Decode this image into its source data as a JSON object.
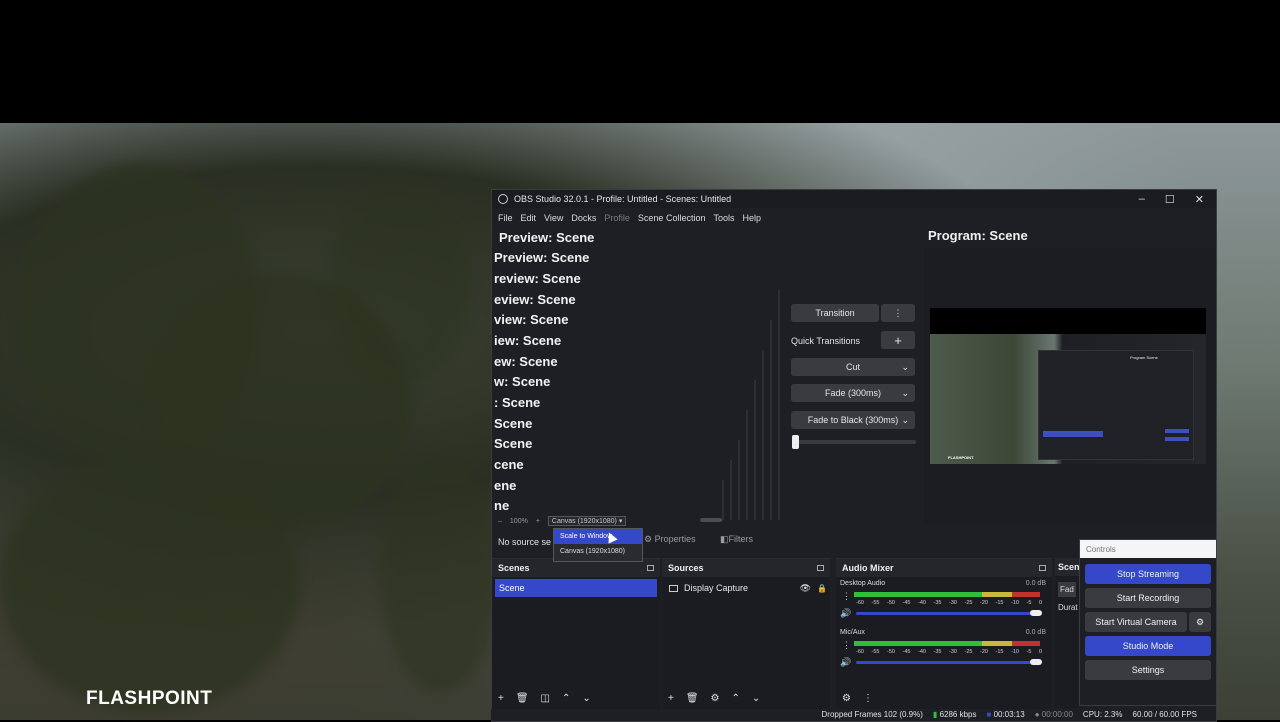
{
  "overlay": {
    "brand": "FLASHPOINT"
  },
  "window": {
    "title": "OBS Studio 32.0.1 - Profile: Untitled - Scenes: Untitled",
    "controls": {
      "minimize": "–",
      "maximize": "☐",
      "close": "✕"
    }
  },
  "menu": [
    "File",
    "Edit",
    "View",
    "Docks",
    "Profile",
    "Scene Collection",
    "Tools",
    "Help"
  ],
  "preview": {
    "lines": [
      "Preview: Scene",
      "Preview: Scene",
      "review: Scene",
      "eview: Scene",
      "view: Scene",
      "iew: Scene",
      "ew: Scene",
      "w: Scene",
      ": Scene",
      " Scene",
      "Scene",
      "cene",
      "ene",
      "ne"
    ],
    "zoom_minus": "–",
    "zoom_value": "100%",
    "zoom_plus": "+",
    "canvas_select": "Canvas (1920x1080)"
  },
  "dropdown": {
    "options": [
      "Scale to Window",
      "Canvas (1920x1080)"
    ],
    "selected_index": 0
  },
  "transitions": {
    "transition_label": "Transition",
    "quick_label": "Quick Transitions",
    "add": "+",
    "more": "⋮",
    "items": [
      "Cut",
      "Fade (300ms)",
      "Fade to Black (300ms)"
    ],
    "slider_position": 0
  },
  "program": {
    "title": "Program: Scene",
    "mini_brand": "FLASHPOINT",
    "mini_title": "Program Scene"
  },
  "context_bar": {
    "no_source": "No source se",
    "properties": "Properties",
    "filters": "Filters"
  },
  "docks": {
    "scenes": {
      "title": "Scenes",
      "items": [
        "Scene"
      ]
    },
    "sources": {
      "title": "Sources",
      "items": [
        {
          "name": "Display Capture"
        }
      ]
    },
    "mixer": {
      "title": "Audio Mixer",
      "channels": [
        {
          "name": "Desktop Audio",
          "db": "0.0 dB",
          "level": 1.0
        },
        {
          "name": "Mic/Aux",
          "db": "0.0 dB",
          "level": 1.0
        }
      ],
      "ticks": [
        "-60",
        "-55",
        "-50",
        "-45",
        "-40",
        "-35",
        "-30",
        "-25",
        "-20",
        "-15",
        "-10",
        "-5",
        "0"
      ]
    },
    "scene_transitions_stub": {
      "title": "Scen",
      "fade": "Fad",
      "duration": "Durat"
    }
  },
  "controls": {
    "title": "Controls",
    "stop_streaming": "Stop Streaming",
    "start_recording": "Start Recording",
    "start_virtual_camera": "Start Virtual Camera",
    "studio_mode": "Studio Mode",
    "settings": "Settings"
  },
  "status": {
    "dropped_frames": "Dropped Frames 102 (0.9%)",
    "bitrate": "6286 kbps",
    "stream_time": "00:03:13",
    "record_time": "00:00:00",
    "cpu": "CPU: 2.3%",
    "fps": "60.00 / 60.00 FPS"
  },
  "colors": {
    "accent": "#3448c9",
    "meter_green": "#2fbf3a",
    "meter_yellow": "#c8b93a",
    "meter_red": "#c2332f"
  }
}
